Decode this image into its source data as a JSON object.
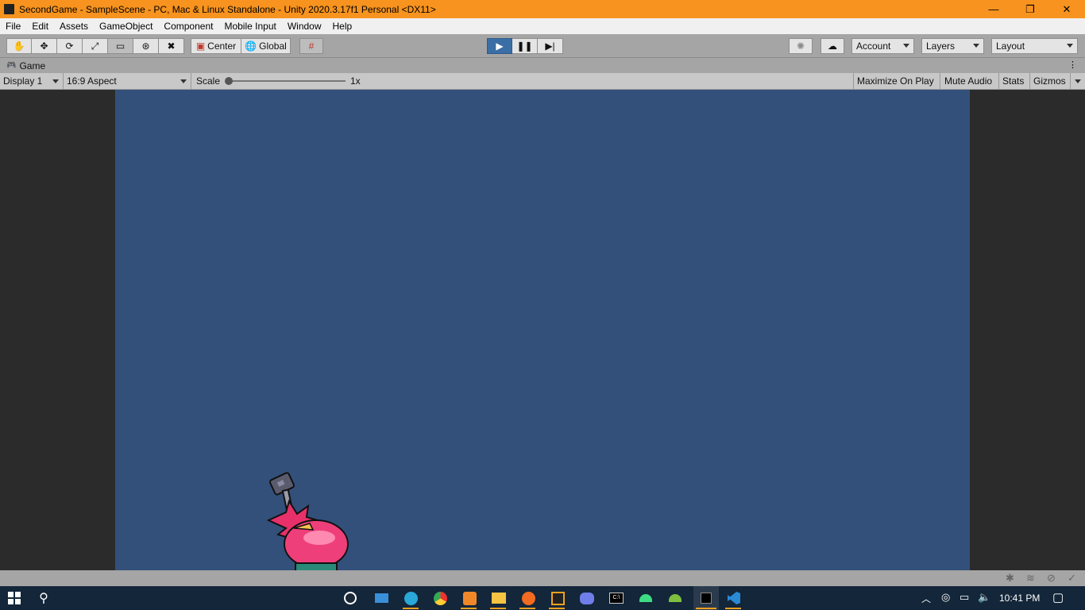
{
  "window": {
    "title": "SecondGame - SampleScene - PC, Mac & Linux Standalone - Unity 2020.3.17f1 Personal <DX11>",
    "controls": {
      "minimize": "—",
      "restore": "❐",
      "close": "✕"
    }
  },
  "menu": [
    "File",
    "Edit",
    "Assets",
    "GameObject",
    "Component",
    "Mobile Input",
    "Window",
    "Help"
  ],
  "toolbar": {
    "tools": [
      "hand-icon",
      "move-icon",
      "rotate-icon",
      "scale-icon",
      "rect-tool-icon",
      "transform-icon",
      "custom-tools-icon"
    ],
    "pivot_label": "Center",
    "space_label": "Global",
    "account_label": "Account",
    "layers_label": "Layers",
    "layout_label": "Layout"
  },
  "tab": {
    "label": "Game"
  },
  "game_bar": {
    "display": "Display 1",
    "aspect": "16:9 Aspect",
    "scale_label": "Scale",
    "scale_value": "1x",
    "maximize": "Maximize On Play",
    "mute": "Mute Audio",
    "stats": "Stats",
    "gizmos": "Gizmos"
  },
  "colors": {
    "titlebar": "#f7931e",
    "viewport": "#33507b",
    "play_active": "#3a6ea5",
    "taskbar": "#13263a"
  },
  "taskbar": {
    "time": "10:41 PM",
    "apps": [
      "steam-icon",
      "mail-icon",
      "edge-icon",
      "chrome-icon",
      "xampp-icon",
      "file-explorer-icon",
      "firefox-icon",
      "unity-hub-icon",
      "discord-icon",
      "terminal-icon",
      "android-studio-icon",
      "android-studio-icon-2",
      "unity-icon",
      "vscode-icon"
    ]
  }
}
